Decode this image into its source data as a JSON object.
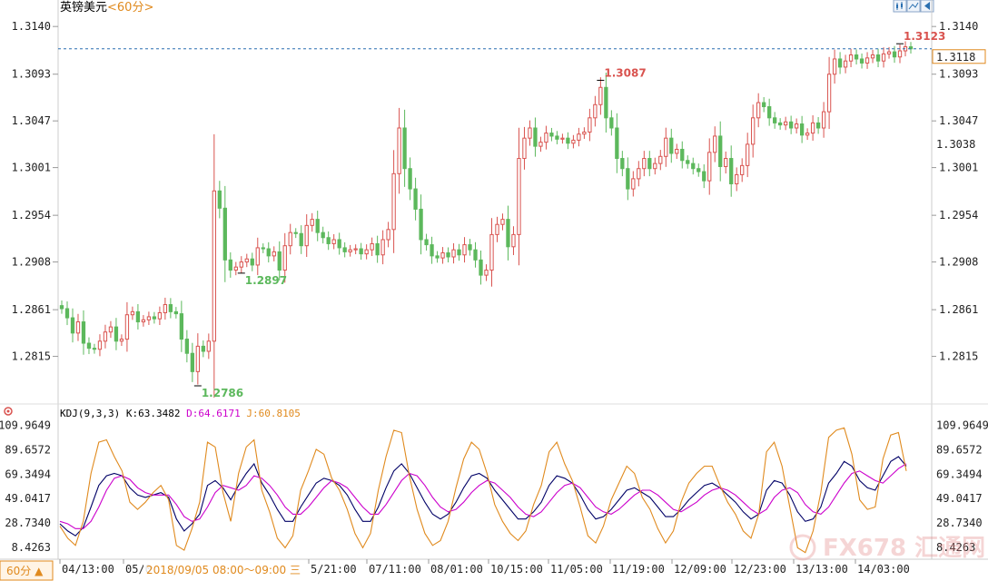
{
  "header": {
    "instrument": "英镑美元",
    "period": "<60分>"
  },
  "toolbar": {
    "icons": [
      "candle-chart-icon",
      "line-chart-icon",
      "back-arrow-icon"
    ]
  },
  "kdj_header": {
    "label": "KDJ(9,3,3)",
    "k": "K:63.3482",
    "d": "D:64.6171",
    "j": "J:60.8105"
  },
  "footer": {
    "period_button": "60分 ▲",
    "crosshair_time": "2018/09/05 08:00～09:00 三"
  },
  "watermark": "FX678 汇通网",
  "colors": {
    "up": "#d9534f",
    "down": "#5cb85c",
    "k_line": "#000066",
    "d_line": "#cc00cc",
    "j_line": "#e08a1e",
    "current_price": "#2a6fb0",
    "high_label": "#d9534f",
    "low_label": "#5cb85c",
    "right_price_2": "#e08a1e"
  },
  "chart_data": [
    {
      "type": "candlestick",
      "y_ticks": [
        "1.3140",
        "1.3093",
        "1.3047",
        "1.3001",
        "1.2954",
        "1.2908",
        "1.2861",
        "1.2815"
      ],
      "ylim": [
        1.2769,
        1.315
      ],
      "x_labels": [
        "04/13:00",
        "05/0",
        "5/21:00",
        "07/11:00",
        "08/01:00",
        "10/15:00",
        "11/05:00",
        "11/19:00",
        "12/09:00",
        "12/23:00",
        "13/13:00",
        "14/03:00"
      ],
      "current_price": "1.3118",
      "right_price_2": "1.3038",
      "annotations": [
        {
          "label": "1.2786",
          "value": 1.2786,
          "kind": "low"
        },
        {
          "label": "1.2897",
          "value": 1.2897,
          "kind": "low"
        },
        {
          "label": "1.3087",
          "value": 1.3087,
          "kind": "high"
        },
        {
          "label": "1.3123",
          "value": 1.3123,
          "kind": "high"
        }
      ],
      "closes": [
        1.2862,
        1.2853,
        1.2838,
        1.2849,
        1.2828,
        1.2823,
        1.2822,
        1.283,
        1.2839,
        1.2844,
        1.283,
        1.2832,
        1.2856,
        1.2859,
        1.2849,
        1.2851,
        1.2854,
        1.2852,
        1.2858,
        1.2866,
        1.2859,
        1.2857,
        1.2832,
        1.2818,
        1.28,
        1.2825,
        1.282,
        1.283,
        1.2978,
        1.2961,
        1.291,
        1.29,
        1.2903,
        1.2908,
        1.2911,
        1.2905,
        1.2922,
        1.2921,
        1.2914,
        1.2918,
        1.29,
        1.2924,
        1.2937,
        1.2936,
        1.2924,
        1.2944,
        1.295,
        1.2937,
        1.2932,
        1.2926,
        1.293,
        1.2922,
        1.2918,
        1.292,
        1.2921,
        1.2916,
        1.292,
        1.2926,
        1.2915,
        1.293,
        1.294,
        1.2995,
        1.304,
        1.3,
        1.298,
        1.296,
        1.293,
        1.2925,
        1.2914,
        1.2912,
        1.2917,
        1.2913,
        1.292,
        1.2915,
        1.2925,
        1.292,
        1.291,
        1.2895,
        1.29,
        1.2935,
        1.2945,
        1.295,
        1.2923,
        1.2935,
        1.301,
        1.303,
        1.304,
        1.3022,
        1.3026,
        1.3035,
        1.3032,
        1.3029,
        1.303,
        1.3025,
        1.3028,
        1.3034,
        1.3036,
        1.305,
        1.3063,
        1.308,
        1.305,
        1.304,
        1.301,
        1.3,
        1.298,
        1.299,
        1.3,
        1.301,
        1.3,
        1.3005,
        1.3012,
        1.303,
        1.3015,
        1.3019,
        1.3008,
        1.3005,
        1.3,
        1.2997,
        1.2988,
        1.3016,
        1.3032,
        1.3002,
        1.301,
        1.2985,
        1.2994,
        1.3003,
        1.3024,
        1.305,
        1.3065,
        1.3061,
        1.305,
        1.3045,
        1.3043,
        1.3046,
        1.304,
        1.3044,
        1.3033,
        1.3035,
        1.3045,
        1.304,
        1.3056,
        1.3093,
        1.3108,
        1.31,
        1.3106,
        1.3112,
        1.3108,
        1.3104,
        1.3109,
        1.3112,
        1.3106,
        1.3113,
        1.3115,
        1.311,
        1.3116,
        1.312,
        1.3118
      ]
    },
    {
      "type": "line",
      "indicator": "KDJ(9,3,3)",
      "y_ticks": [
        "109.9649",
        "89.6572",
        "69.3494",
        "49.0417",
        "28.7340",
        "8.4263"
      ],
      "ylim": [
        0,
        115
      ],
      "series": [
        {
          "name": "K",
          "values": [
            28,
            22,
            18,
            25,
            42,
            60,
            68,
            70,
            68,
            58,
            52,
            50,
            52,
            54,
            50,
            32,
            22,
            28,
            36,
            60,
            64,
            58,
            48,
            60,
            70,
            78,
            62,
            52,
            40,
            30,
            30,
            42,
            52,
            62,
            66,
            64,
            60,
            52,
            40,
            30,
            30,
            42,
            58,
            72,
            78,
            70,
            58,
            46,
            36,
            32,
            36,
            46,
            58,
            68,
            70,
            66,
            56,
            48,
            40,
            32,
            32,
            38,
            46,
            60,
            68,
            66,
            62,
            52,
            40,
            32,
            34,
            40,
            48,
            56,
            58,
            54,
            50,
            42,
            34,
            34,
            40,
            48,
            54,
            60,
            62,
            58,
            52,
            46,
            38,
            32,
            36,
            56,
            64,
            62,
            52,
            38,
            30,
            32,
            42,
            62,
            70,
            80,
            76,
            64,
            58,
            56,
            68,
            80,
            84,
            76
          ]
        },
        {
          "name": "D",
          "values": [
            30,
            28,
            24,
            24,
            30,
            42,
            56,
            66,
            68,
            65,
            58,
            54,
            52,
            52,
            52,
            44,
            34,
            30,
            32,
            42,
            54,
            60,
            58,
            56,
            60,
            68,
            66,
            60,
            52,
            42,
            36,
            36,
            42,
            50,
            58,
            64,
            62,
            58,
            50,
            42,
            36,
            36,
            44,
            54,
            64,
            70,
            68,
            60,
            50,
            42,
            38,
            40,
            46,
            54,
            60,
            64,
            62,
            56,
            50,
            42,
            36,
            34,
            38,
            46,
            54,
            60,
            62,
            58,
            50,
            42,
            38,
            36,
            40,
            46,
            52,
            56,
            56,
            52,
            46,
            40,
            38,
            42,
            46,
            52,
            56,
            58,
            56,
            52,
            46,
            40,
            36,
            40,
            50,
            56,
            58,
            54,
            44,
            38,
            36,
            42,
            52,
            62,
            70,
            72,
            68,
            64,
            62,
            68,
            74,
            78
          ]
        },
        {
          "name": "J",
          "values": [
            26,
            16,
            10,
            30,
            70,
            96,
            98,
            84,
            72,
            46,
            40,
            46,
            54,
            60,
            48,
            10,
            6,
            24,
            46,
            96,
            92,
            54,
            30,
            70,
            92,
            98,
            56,
            38,
            16,
            8,
            18,
            56,
            72,
            90,
            86,
            66,
            56,
            40,
            20,
            8,
            20,
            56,
            84,
            106,
            104,
            68,
            40,
            20,
            10,
            14,
            30,
            58,
            82,
            96,
            90,
            70,
            44,
            30,
            20,
            14,
            22,
            44,
            60,
            88,
            96,
            78,
            64,
            42,
            18,
            12,
            26,
            48,
            62,
            76,
            70,
            50,
            40,
            24,
            12,
            22,
            46,
            62,
            70,
            76,
            76,
            60,
            46,
            36,
            22,
            16,
            36,
            88,
            96,
            76,
            42,
            8,
            4,
            22,
            54,
            100,
            106,
            108,
            86,
            48,
            40,
            42,
            82,
            102,
            104,
            72
          ]
        }
      ]
    }
  ]
}
